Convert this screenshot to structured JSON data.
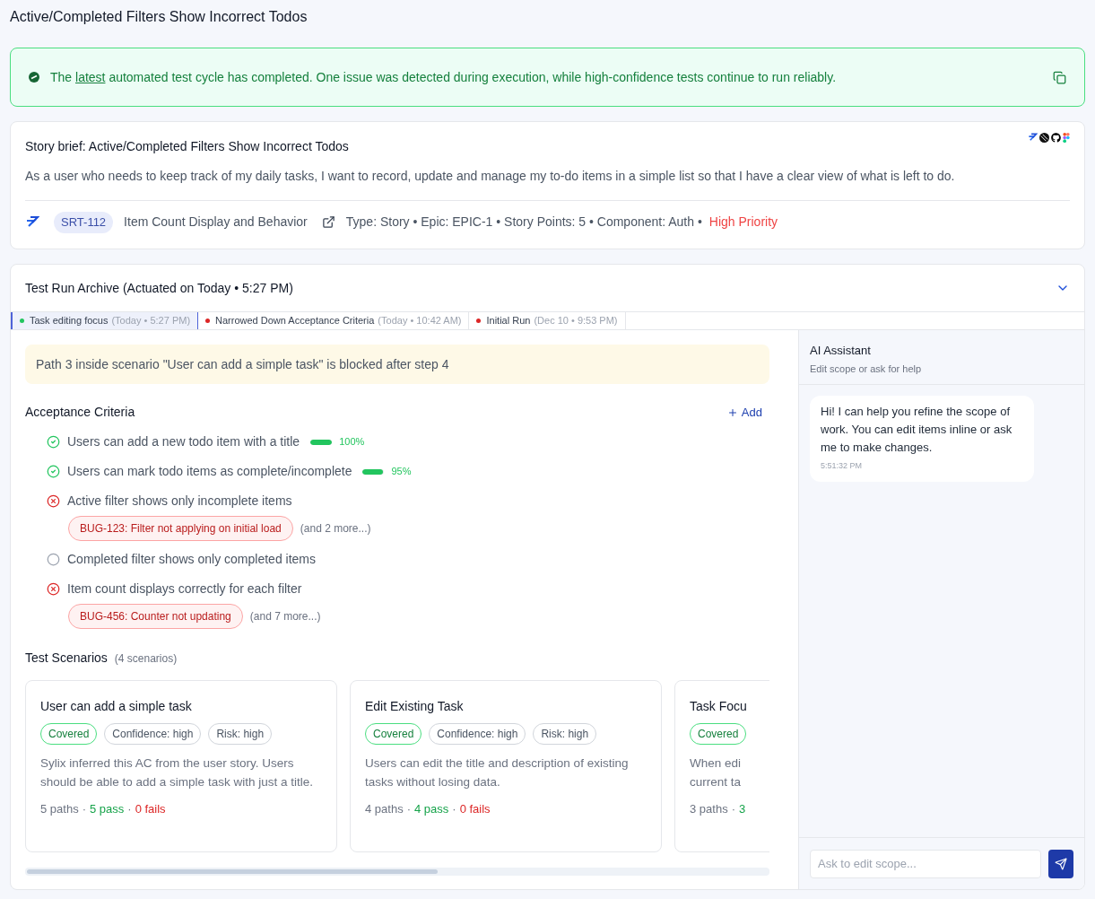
{
  "page_title": "Active/Completed Filters Show Incorrect Todos",
  "banner": {
    "text_before": "The",
    "link": "latest",
    "text_after": "automated test cycle has completed. One issue was detected during execution, while high-confidence tests continue to run reliably.",
    "kind": "success"
  },
  "story": {
    "title": "Story brief: Active/Completed Filters Show Incorrect Todos",
    "description": "As a user who needs to keep track of my daily tasks, I want to record, update and manage my to-do items in a simple list so that I have a clear view of what is left to do.",
    "key": "SRT-112",
    "name": "Item Count Display and Behavior",
    "separator": "•",
    "meta": [
      "Type: Story",
      "Epic: EPIC-1",
      "Story Points: 5",
      "Component: Auth"
    ],
    "priority": {
      "text": "High Priority",
      "kind": "high"
    }
  },
  "archive": {
    "title": "Test Run Archive (Actuated on Today • 5:27 PM)",
    "expanded": true,
    "tabs": [
      {
        "label": "Task editing focus",
        "meta": "(Today • 5:27 PM)",
        "color": "#22c55e",
        "selected": true
      },
      {
        "label": "Narrowed Down Acceptance Criteria",
        "meta": "(Today • 10:42 AM)",
        "color": "#dc2626",
        "selected": false
      },
      {
        "label": "Initial Run",
        "meta": "(Dec 10 • 9:53 PM)",
        "color": "#dc2626",
        "selected": false
      }
    ],
    "alert": "Path 3 inside scenario \"User can add a simple task\" is blocked after step 4",
    "criteria_title": "Acceptance Criteria",
    "add_label": "Add",
    "criteria": [
      {
        "text": "Users can add a new todo item with a title",
        "kind": "pass",
        "level": 1,
        "percent": "100%"
      },
      {
        "text": "Users can mark todo items as complete/incomplete",
        "kind": "pass",
        "level": 0.95,
        "percent": "95%"
      },
      {
        "text": "Active filter shows only incomplete items",
        "kind": "fail",
        "bug": "BUG-123: Filter not applying on initial load",
        "more": "(and 2 more...)"
      },
      {
        "text": "Completed filter shows only completed items",
        "kind": "pending"
      },
      {
        "text": "Item count displays correctly for each filter",
        "kind": "fail",
        "bug": "BUG-456: Counter not updating",
        "more": "(and 7 more...)"
      }
    ],
    "scenarios_title": "Test Scenarios",
    "scenarios_count": "(4 scenarios)",
    "scenarios": [
      {
        "title": "User can add a simple task",
        "tags": [
          {
            "text": "Covered",
            "kind": "covered"
          },
          {
            "text": "Confidence: high",
            "kind": "neutral"
          },
          {
            "text": "Risk: high",
            "kind": "neutral"
          }
        ],
        "description": "Sylix inferred this AC from the user story. Users should be able to add a simple task with just a title.",
        "stats": [
          {
            "text": "5 paths",
            "kind": "neutral"
          },
          {
            "text": "·",
            "kind": "neutral"
          },
          {
            "text": "5 pass",
            "kind": "pass"
          },
          {
            "text": "·",
            "kind": "neutral"
          },
          {
            "text": "0 fails",
            "kind": "fail"
          }
        ]
      },
      {
        "title": "Edit Existing Task",
        "tags": [
          {
            "text": "Covered",
            "kind": "covered"
          },
          {
            "text": "Confidence: high",
            "kind": "neutral"
          },
          {
            "text": "Risk: high",
            "kind": "neutral"
          }
        ],
        "description": "Users can edit the title and description of existing tasks without losing data.",
        "stats": [
          {
            "text": "4 paths",
            "kind": "neutral"
          },
          {
            "text": "·",
            "kind": "neutral"
          },
          {
            "text": "4 pass",
            "kind": "pass"
          },
          {
            "text": "·",
            "kind": "neutral"
          },
          {
            "text": "0 fails",
            "kind": "fail"
          }
        ]
      },
      {
        "title": "Task Focu",
        "tags": [
          {
            "text": "Covered",
            "kind": "covered"
          }
        ],
        "description_lines": [
          "When edi",
          "current ta"
        ],
        "stats": [
          {
            "text": "3 paths",
            "kind": "neutral"
          },
          {
            "text": "·",
            "kind": "neutral"
          },
          {
            "text": "3",
            "kind": "pass"
          }
        ]
      }
    ]
  },
  "assistant": {
    "title": "AI Assistant",
    "subtitle": "Edit scope or ask for help",
    "messages": [
      {
        "text": "Hi! I can help you refine the scope of work. You can edit items inline or ask me to make changes.",
        "time": "5:51:32 PM"
      }
    ],
    "input_placeholder": "Ask to edit scope..."
  }
}
